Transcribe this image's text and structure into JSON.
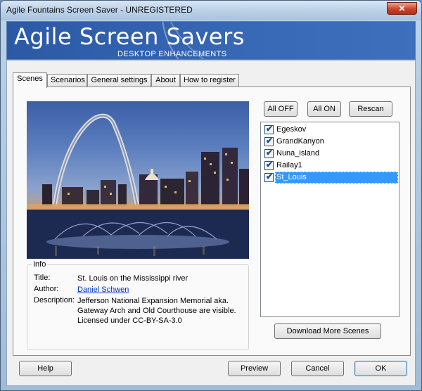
{
  "window": {
    "title": "Agile Fountains Screen Saver - UNREGISTERED",
    "close_glyph": "✕"
  },
  "banner": {
    "title": "Agile Screen Savers",
    "subtitle": "DESKTOP ENHANCEMENTS"
  },
  "tabs": [
    {
      "label": "Scenes",
      "active": true
    },
    {
      "label": "Scenarios",
      "active": false
    },
    {
      "label": "General settings",
      "active": false
    },
    {
      "label": "About",
      "active": false
    },
    {
      "label": "How to register",
      "active": false
    }
  ],
  "scene_buttons": {
    "all_off": "All OFF",
    "all_on": "All ON",
    "rescan": "Rescan"
  },
  "scenes": [
    {
      "label": "Egeskov",
      "checked": true,
      "selected": false
    },
    {
      "label": "GrandKanyon",
      "checked": true,
      "selected": false
    },
    {
      "label": "Nuna_island",
      "checked": true,
      "selected": false
    },
    {
      "label": "Railay1",
      "checked": true,
      "selected": false
    },
    {
      "label": "St_Louis",
      "checked": true,
      "selected": true
    }
  ],
  "checkmark": "✔",
  "info": {
    "legend": "Info",
    "title_label": "Title:",
    "title_value": "St. Louis on the Mississippi river",
    "author_label": "Author:",
    "author_value": "Daniel Schwen",
    "description_label": "Description:",
    "description_value": "Jefferson National Expansion Memorial aka. Gateway Arch and Old Courthouse are visible. Licensed under CC-BY-SA-3.0"
  },
  "download_button": "Download More Scenes",
  "footer": {
    "help": "Help",
    "preview": "Preview",
    "cancel": "Cancel",
    "ok": "OK"
  },
  "colors": {
    "banner": "#2b59a6",
    "selection": "#3399ff",
    "link": "#0033cc"
  }
}
